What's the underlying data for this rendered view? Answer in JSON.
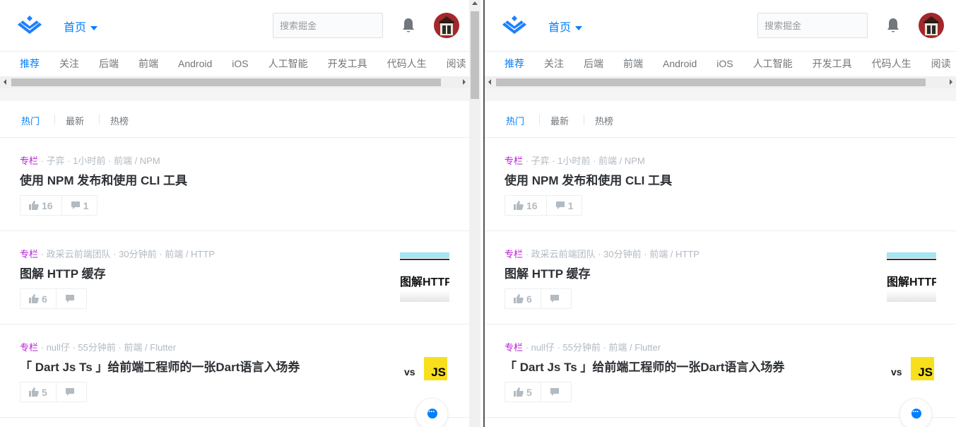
{
  "header": {
    "home_label": "首页",
    "search_placeholder": "搜索掘金"
  },
  "tabs": [
    "推荐",
    "关注",
    "后端",
    "前端",
    "Android",
    "iOS",
    "人工智能",
    "开发工具",
    "代码人生",
    "阅读"
  ],
  "active_tab": "推荐",
  "subnav": [
    "热门",
    "最新",
    "热榜"
  ],
  "active_subnav": "热门",
  "entries": [
    {
      "type": "专栏",
      "author": "子弈",
      "time": "1小时前",
      "tags": "前端 / NPM",
      "title": "使用 NPM 发布和使用 CLI 工具",
      "likes": "16",
      "comments": "1",
      "thumb": "none"
    },
    {
      "type": "专栏",
      "author": "政采云前端团队",
      "time": "30分钟前",
      "tags": "前端 / HTTP",
      "title": "图解 HTTP 缓存",
      "likes": "6",
      "comments": "",
      "thumb": "http",
      "thumb_text": "图解HTTP"
    },
    {
      "type": "专栏",
      "author": "null仔",
      "time": "55分钟前",
      "tags": "前端 / Flutter",
      "title": "「 Dart Js Ts 」给前端工程师的一张Dart语言入场券",
      "likes": "5",
      "comments": "",
      "thumb": "js",
      "thumb_vs": "vs",
      "thumb_js": "JS"
    }
  ],
  "colors": {
    "accent": "#007fff",
    "column_tag": "#b71ed7",
    "meta_gray": "#b2bac2",
    "title_dark": "#2e3135"
  }
}
